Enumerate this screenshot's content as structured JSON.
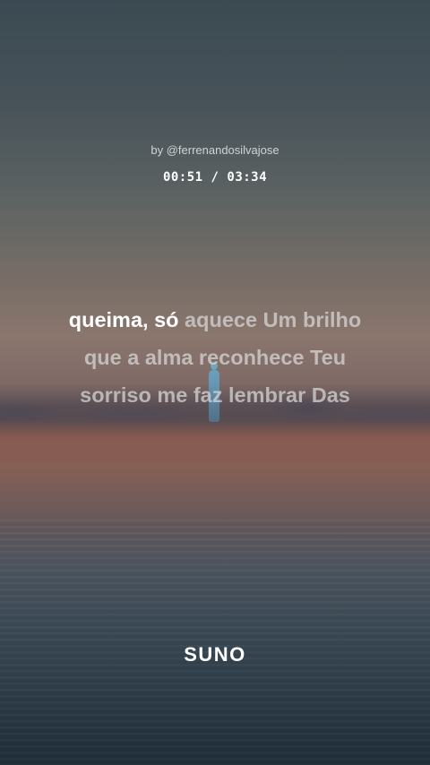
{
  "song": {
    "byline": "by @ferrenandosilvajose",
    "elapsed": "00:51",
    "separator": " / ",
    "duration": "03:34"
  },
  "lyrics": {
    "line1_sung": "queima, só",
    "line1_rest": "aquece Um brilho",
    "line2": "que a alma reconhece Teu",
    "line3": "sorriso me faz lembrar Das"
  },
  "brand": {
    "logo_text": "SUNO"
  }
}
